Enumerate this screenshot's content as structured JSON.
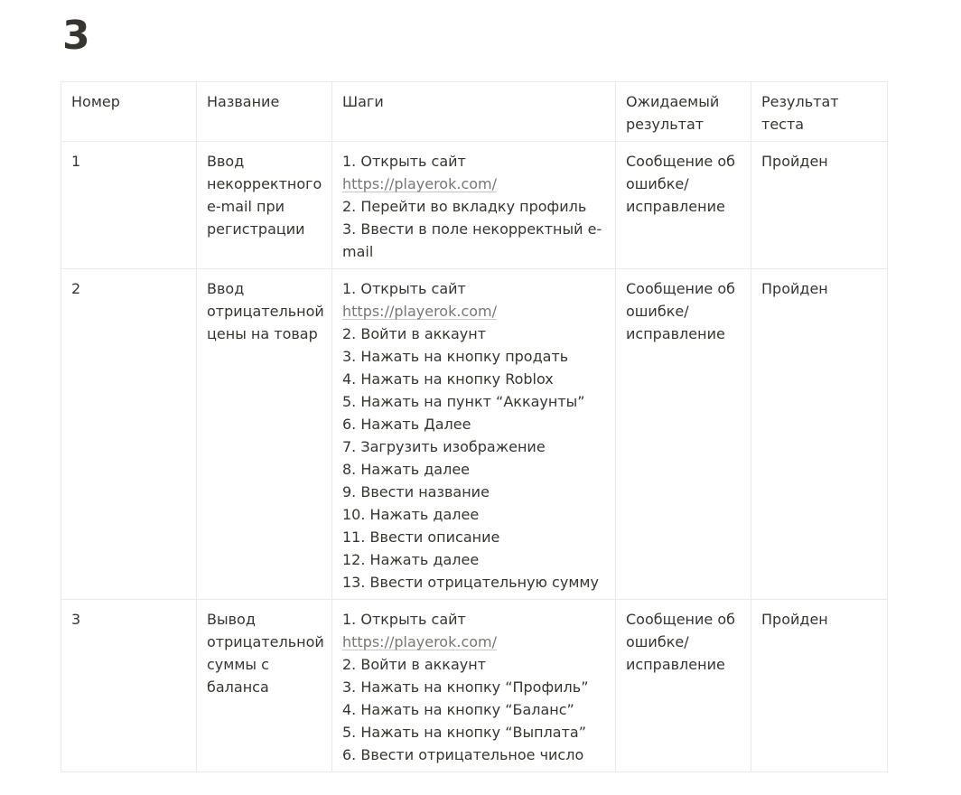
{
  "page": {
    "title": "3"
  },
  "table": {
    "headers": [
      "Номер",
      "Название",
      "Шаги",
      "Ожидаемый результат",
      "Результат теста"
    ],
    "rows": [
      {
        "number": "1",
        "name": "Ввод некорректного e-mail при регистрации",
        "steps": [
          "1. Открыть сайт",
          "https://playerok.com/",
          "2. Перейти во вкладку профиль",
          "3. Ввести в поле некорректный e-mail"
        ],
        "expected": "Сообщение об ошибке/исправление",
        "result": "Пройден"
      },
      {
        "number": "2",
        "name": "Ввод отрицательной цены на товар",
        "steps": [
          "1. Открыть сайт",
          "https://playerok.com/",
          "2. Войти в аккаунт",
          "3. Нажать на кнопку продать",
          "4. Нажать на кнопку Roblox",
          "5. Нажать на пункт “Аккаунты”",
          "6. Нажать Далее",
          "7. Загрузить изображение",
          "8. Нажать далее",
          "9. Ввести название",
          "10. Нажать далее",
          "11. Ввести описание",
          "12. Нажать далее",
          "13. Ввести отрицательную сумму"
        ],
        "expected": "Сообщение об ошибке/исправление",
        "result": "Пройден"
      },
      {
        "number": "3",
        "name": "Вывод отрицательной суммы с баланса",
        "steps": [
          "1. Открыть сайт",
          "https://playerok.com/",
          "2. Войти в аккаунт",
          "3. Нажать на кнопку “Профиль”",
          "4. Нажать на кнопку “Баланс”",
          "5. Нажать на кнопку “Выплата”",
          "6. Ввести отрицательное число"
        ],
        "expected": "Сообщение об ошибке/исправление",
        "result": "Пройден"
      }
    ]
  }
}
